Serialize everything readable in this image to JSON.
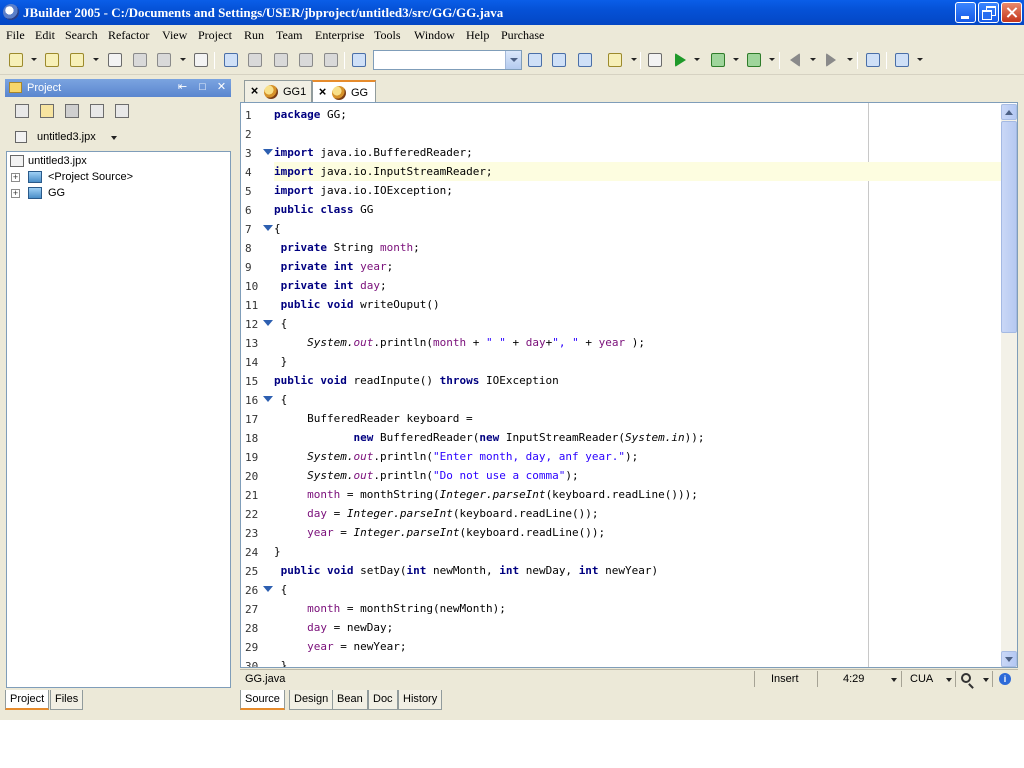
{
  "window": {
    "title": "JBuilder 2005 - C:/Documents and Settings/USER/jbproject/untitled3/src/GG/GG.java"
  },
  "menu": [
    "File",
    "Edit",
    "Search",
    "Refactor",
    "View",
    "Project",
    "Run",
    "Team",
    "Enterprise",
    "Tools",
    "Window",
    "Help",
    "Purchase"
  ],
  "toolbar": {
    "search_combo_value": ""
  },
  "project_pane": {
    "title": "Project",
    "selector_label": "untitled3.jpx",
    "tree": [
      {
        "label": "untitled3.jpx",
        "kind": "file"
      },
      {
        "label": "<Project Source>",
        "kind": "package",
        "expander": "+"
      },
      {
        "label": "GG",
        "kind": "package",
        "expander": "+"
      }
    ],
    "tabs": [
      "Project",
      "Files"
    ]
  },
  "editor": {
    "tabs": [
      "GG1",
      "GG"
    ],
    "active_tab": "GG",
    "lines": [
      [
        {
          "t": "package",
          "c": "kw"
        },
        {
          "t": " GG;"
        }
      ],
      [],
      [
        {
          "t": "import",
          "c": "kw"
        },
        {
          "t": " java.io.BufferedReader;"
        }
      ],
      [
        {
          "t": "import",
          "c": "kw"
        },
        {
          "t": " java.io.InputStreamReader;"
        }
      ],
      [
        {
          "t": "import",
          "c": "kw"
        },
        {
          "t": " java.io.IOException;"
        }
      ],
      [
        {
          "t": "public class",
          "c": "kw"
        },
        {
          "t": " GG"
        }
      ],
      [
        {
          "t": "{"
        }
      ],
      [
        {
          "t": " "
        },
        {
          "t": "private",
          "c": "kw"
        },
        {
          "t": " String "
        },
        {
          "t": "month",
          "c": "fld"
        },
        {
          "t": ";"
        }
      ],
      [
        {
          "t": " "
        },
        {
          "t": "private int",
          "c": "kw"
        },
        {
          "t": " "
        },
        {
          "t": "year",
          "c": "fld"
        },
        {
          "t": ";"
        }
      ],
      [
        {
          "t": " "
        },
        {
          "t": "private int",
          "c": "kw"
        },
        {
          "t": " "
        },
        {
          "t": "day",
          "c": "fld"
        },
        {
          "t": ";"
        }
      ],
      [
        {
          "t": " "
        },
        {
          "t": "public void",
          "c": "kw"
        },
        {
          "t": " writeOuput()"
        }
      ],
      [
        {
          "t": " {"
        }
      ],
      [
        {
          "t": "     "
        },
        {
          "t": "System.",
          "c": "st"
        },
        {
          "t": "out",
          "c": "st fld"
        },
        {
          "t": ".println("
        },
        {
          "t": "month",
          "c": "fld"
        },
        {
          "t": " + "
        },
        {
          "t": "\" \"",
          "c": "str"
        },
        {
          "t": " + "
        },
        {
          "t": "day",
          "c": "fld"
        },
        {
          "t": "+"
        },
        {
          "t": "\", \"",
          "c": "str"
        },
        {
          "t": " + "
        },
        {
          "t": "year",
          "c": "fld"
        },
        {
          "t": " );"
        }
      ],
      [
        {
          "t": " }"
        }
      ],
      [
        {
          "t": "public void",
          "c": "kw"
        },
        {
          "t": " readInpute() "
        },
        {
          "t": "throws",
          "c": "kw"
        },
        {
          "t": " IOException"
        }
      ],
      [
        {
          "t": " {"
        }
      ],
      [
        {
          "t": "     BufferedReader keyboard ="
        }
      ],
      [
        {
          "t": "            "
        },
        {
          "t": "new",
          "c": "kw"
        },
        {
          "t": " BufferedReader("
        },
        {
          "t": "new",
          "c": "kw"
        },
        {
          "t": " InputStreamReader("
        },
        {
          "t": "System.in",
          "c": "st"
        },
        {
          "t": "));"
        }
      ],
      [
        {
          "t": "     "
        },
        {
          "t": "System.",
          "c": "st"
        },
        {
          "t": "out",
          "c": "st fld"
        },
        {
          "t": ".println("
        },
        {
          "t": "\"Enter month, day, anf year.\"",
          "c": "str"
        },
        {
          "t": ");"
        }
      ],
      [
        {
          "t": "     "
        },
        {
          "t": "System.",
          "c": "st"
        },
        {
          "t": "out",
          "c": "st fld"
        },
        {
          "t": ".println("
        },
        {
          "t": "\"Do not use a comma\"",
          "c": "str"
        },
        {
          "t": ");"
        }
      ],
      [
        {
          "t": "     "
        },
        {
          "t": "month",
          "c": "fld"
        },
        {
          "t": " = monthString("
        },
        {
          "t": "Integer.parseInt",
          "c": "st"
        },
        {
          "t": "(keyboard.readLine()));"
        }
      ],
      [
        {
          "t": "     "
        },
        {
          "t": "day",
          "c": "fld"
        },
        {
          "t": " = "
        },
        {
          "t": "Integer.parseInt",
          "c": "st"
        },
        {
          "t": "(keyboard.readLine());"
        }
      ],
      [
        {
          "t": "     "
        },
        {
          "t": "year",
          "c": "fld"
        },
        {
          "t": " = "
        },
        {
          "t": "Integer.parseInt",
          "c": "st"
        },
        {
          "t": "(keyboard.readLine());"
        }
      ],
      [
        {
          "t": "}"
        }
      ],
      [
        {
          "t": " "
        },
        {
          "t": "public void",
          "c": "kw"
        },
        {
          "t": " setDay("
        },
        {
          "t": "int",
          "c": "kw"
        },
        {
          "t": " newMonth, "
        },
        {
          "t": "int",
          "c": "kw"
        },
        {
          "t": " newDay, "
        },
        {
          "t": "int",
          "c": "kw"
        },
        {
          "t": " newYear)"
        }
      ],
      [
        {
          "t": " {"
        }
      ],
      [
        {
          "t": "     "
        },
        {
          "t": "month",
          "c": "fld"
        },
        {
          "t": " = monthString(newMonth);"
        }
      ],
      [
        {
          "t": "     "
        },
        {
          "t": "day",
          "c": "fld"
        },
        {
          "t": " = newDay;"
        }
      ],
      [
        {
          "t": "     "
        },
        {
          "t": "year",
          "c": "fld"
        },
        {
          "t": " = newYear;"
        }
      ],
      [
        {
          "t": " }"
        }
      ]
    ],
    "line_numbers": [
      "1",
      "2",
      "3",
      "4",
      "5",
      "6",
      "7",
      "8",
      "9",
      "10",
      "11",
      "12",
      "13",
      "14",
      "15",
      "16",
      "17",
      "18",
      "19",
      "20",
      "21",
      "22",
      "23",
      "24",
      "25",
      "26",
      "27",
      "28",
      "29",
      "30"
    ],
    "fold_lines": [
      3,
      7,
      12,
      16,
      26
    ],
    "current_line": 4,
    "bottom_tabs": [
      "Source",
      "Design",
      "Bean",
      "Doc",
      "History"
    ]
  },
  "status": {
    "file": "GG.java",
    "mode": "Insert",
    "position": "4:29",
    "keymap": "CUA"
  }
}
